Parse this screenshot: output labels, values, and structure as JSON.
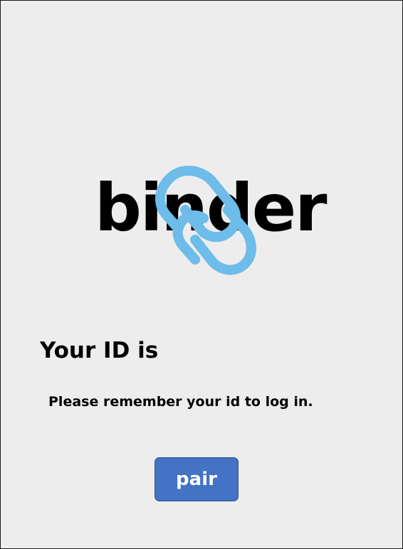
{
  "logo": {
    "text": "binder",
    "icon": "paperclip-link-icon",
    "icon_color": "#6dbcea"
  },
  "heading": {
    "text": "Your ID is"
  },
  "reminder": {
    "text": "Please remember your id to log in."
  },
  "pair_button": {
    "label": "pair",
    "color": "#4472c4"
  }
}
